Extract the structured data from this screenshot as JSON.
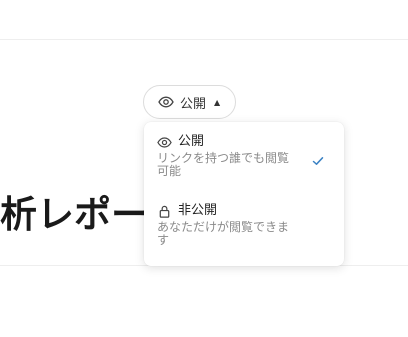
{
  "visibility_button": {
    "label": "公開",
    "eye_icon": "eye-icon",
    "caret_icon": "caret-up-icon"
  },
  "title": "析レポー",
  "dropdown": {
    "options": [
      {
        "label": "公開",
        "description": "リンクを持つ誰でも閲覧可能",
        "icon": "eye-icon",
        "selected": true
      },
      {
        "label": "非公開",
        "description": "あなただけが閲覧できます",
        "icon": "lock-icon",
        "selected": false
      }
    ]
  },
  "colors": {
    "accent_check": "#3b82c4",
    "text_primary": "#222222",
    "text_secondary": "#8a8a8a"
  }
}
